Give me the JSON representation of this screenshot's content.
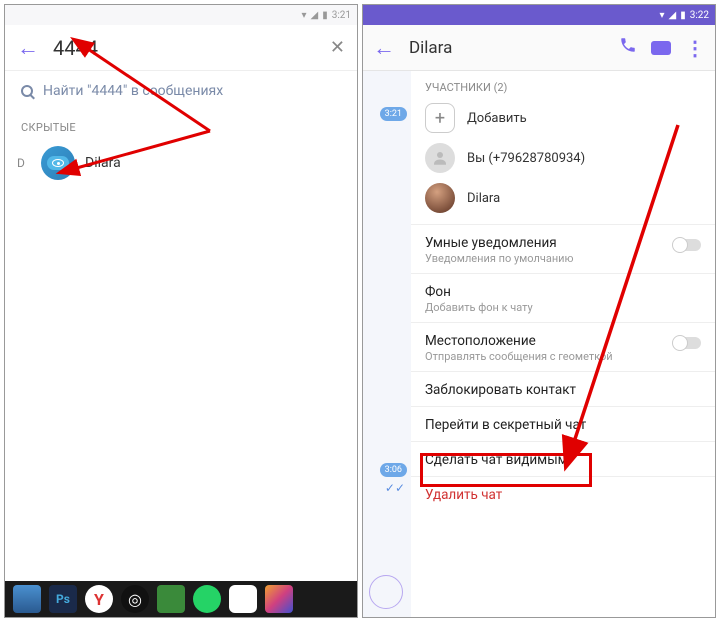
{
  "status": {
    "time_left": "3:21",
    "time_right": "3:22"
  },
  "left": {
    "search_value": "4444",
    "suggest": "Найти \"4444\" в сообщениях",
    "section": "СКРЫТЫЕ",
    "letter": "D",
    "contact": "Dilara"
  },
  "right": {
    "title": "Dilara",
    "participants_label": "УЧАСТНИКИ (2)",
    "add": "Добавить",
    "you": "Вы (+79628780934)",
    "p2": "Dilara",
    "smart_title": "Умные уведомления",
    "smart_sub": "Уведомления по умолчанию",
    "bg_title": "Фон",
    "bg_sub": "Добавить фон к чату",
    "loc_title": "Местоположение",
    "loc_sub": "Отправлять сообщения с геометкой",
    "block": "Заблокировать контакт",
    "secret": "Перейти в секретный чат",
    "visible": "Сделать чат видимым",
    "delete": "Удалить чат",
    "time1": "3:21",
    "time2": "3:06"
  }
}
